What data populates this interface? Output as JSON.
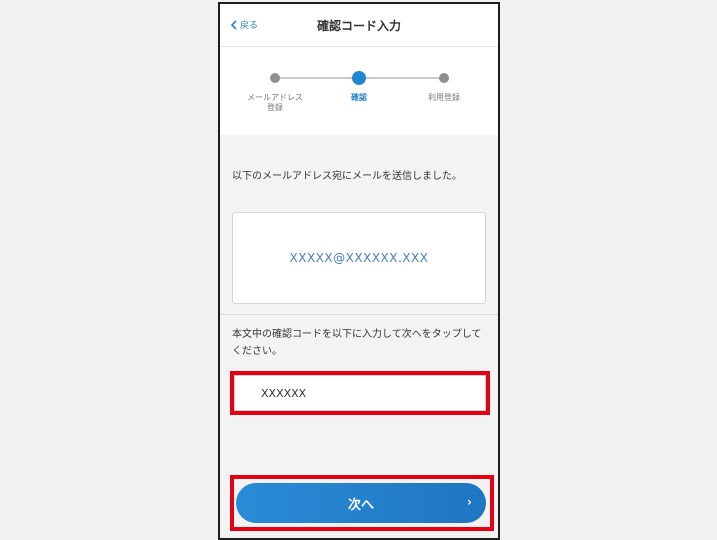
{
  "nav": {
    "back_label": "戻る",
    "title": "確認コード入力"
  },
  "steps": [
    {
      "label": "メールアドレス\n登録",
      "state": "done"
    },
    {
      "label": "確認",
      "state": "active"
    },
    {
      "label": "利用登録",
      "state": "pending"
    }
  ],
  "email_notice": "以下のメールアドレス宛にメールを送信しました。",
  "email_value": "XXXXX@XXXXXX.XXX",
  "code_instruction": "本文中の確認コードを以下に入力して次へをタップしてください。",
  "code_input_value": "XXXXXX",
  "next_button_label": "次へ",
  "next_arrow": "›",
  "colors": {
    "accent": "#1f86d3",
    "highlight": "#e60012",
    "email_text": "#4a7cc0"
  }
}
